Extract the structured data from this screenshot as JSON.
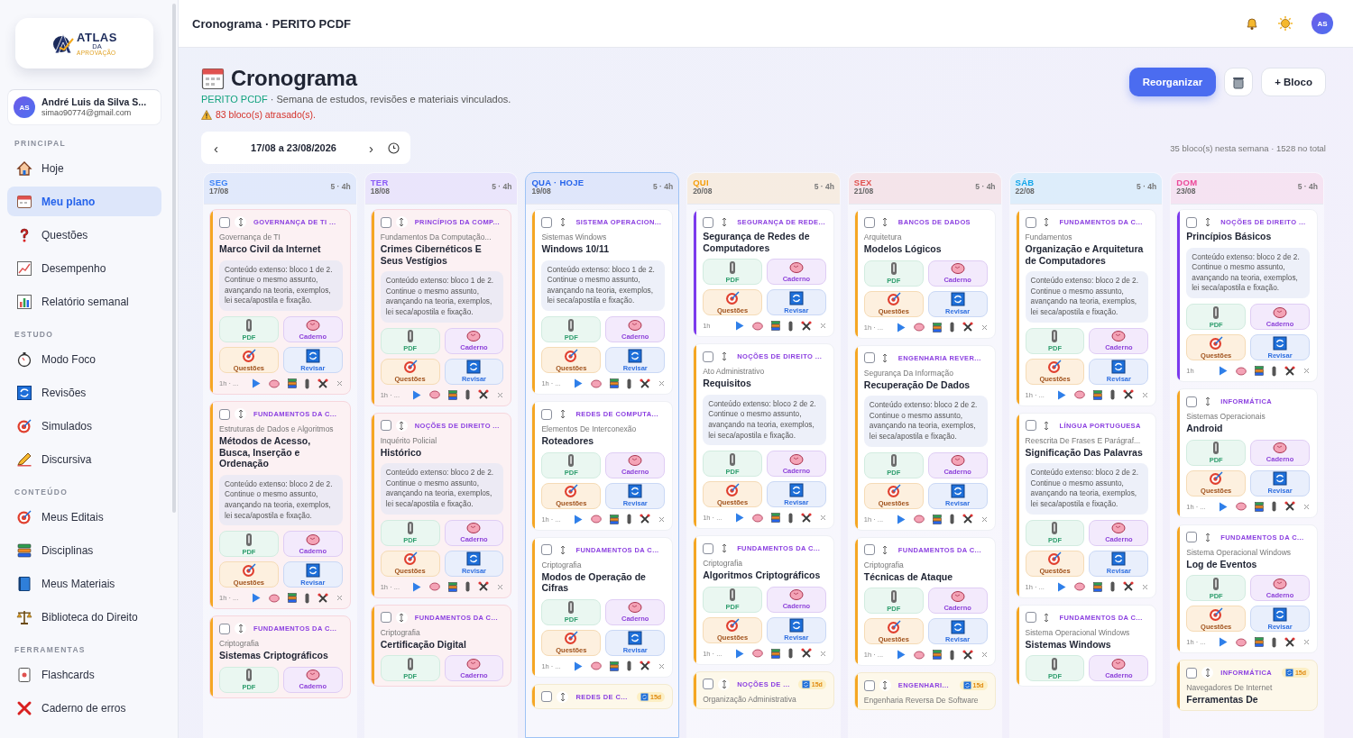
{
  "sidebar": {
    "logo": {
      "name": "ATLAS",
      "small": "DA",
      "tagline": "APROVAÇÃO"
    },
    "user": {
      "initials": "AS",
      "name": "André Luis da Silva S...",
      "email": "simao90774@gmail.com"
    },
    "sections": [
      {
        "title": "PRINCIPAL",
        "items": [
          {
            "label": "Hoje",
            "selected": false
          },
          {
            "label": "Meu plano",
            "selected": true
          },
          {
            "label": "Questões",
            "selected": false
          },
          {
            "label": "Desempenho",
            "selected": false
          },
          {
            "label": "Relatório semanal",
            "selected": false
          }
        ]
      },
      {
        "title": "ESTUDO",
        "items": [
          {
            "label": "Modo Foco",
            "selected": false
          },
          {
            "label": "Revisões",
            "selected": false
          },
          {
            "label": "Simulados",
            "selected": false
          },
          {
            "label": "Discursiva",
            "selected": false
          }
        ]
      },
      {
        "title": "CONTEÚDO",
        "items": [
          {
            "label": "Meus Editais",
            "selected": false
          },
          {
            "label": "Disciplinas",
            "selected": false
          },
          {
            "label": "Meus Materiais",
            "selected": false
          },
          {
            "label": "Biblioteca do Direito",
            "selected": false
          }
        ]
      },
      {
        "title": "FERRAMENTAS",
        "items": [
          {
            "label": "Flashcards",
            "selected": false
          },
          {
            "label": "Caderno de erros",
            "selected": false
          }
        ]
      }
    ]
  },
  "topbar": {
    "title": "Cronograma · PERITO PCDF",
    "avatar": "AS"
  },
  "header": {
    "title": "Cronograma",
    "project": "PERITO PCDF",
    "subtitle": "· Semana de estudos, revisões e materiais vinculados.",
    "warning": "83 bloco(s) atrasado(s).",
    "primary_button": "Reorganizar",
    "add_button": "+ Bloco"
  },
  "week": {
    "prev": "‹",
    "range": "17/08 a 23/08/2026",
    "next": "›",
    "summary": "35 bloco(s) nesta semana · 1528 no total"
  },
  "days": [
    {
      "name": "SEG",
      "date": "17/08",
      "summary": "5 · 4h",
      "color": "#3b82f6",
      "today": false,
      "cards": [
        {
          "subject": "GOVERNANÇA DE TI ...",
          "topic": "Governança de TI",
          "title": "Marco Civil da Internet",
          "note": "Conteúdo extenso: bloco 1 de 2. Continue o mesmo assunto, avançando na teoria, exemplos, lei seca/apostila e fixação.",
          "actions": [
            "PDF",
            "Caderno",
            "Questões",
            "Revisar"
          ],
          "time": "1h · ...",
          "color": "#f5a623",
          "overdue": true,
          "due_review": false,
          "checked": false
        },
        {
          "subject": "FUNDAMENTOS DA C...",
          "topic": "Estruturas de Dados e Algoritmos",
          "title": "Métodos de Acesso, Busca, Inserção e Ordenação",
          "note": "Conteúdo extenso: bloco 2 de 2. Continue o mesmo assunto, avançando na teoria, exemplos, lei seca/apostila e fixação.",
          "actions": [
            "PDF",
            "Caderno",
            "Questões",
            "Revisar"
          ],
          "time": "1h · ...",
          "color": "#f5a623",
          "overdue": true,
          "due_review": false,
          "checked": false
        },
        {
          "subject": "FUNDAMENTOS DA C...",
          "topic": "Criptografia",
          "title": "Sistemas Criptográficos",
          "actions": [
            "PDF",
            "Caderno"
          ],
          "color": "#f5a623",
          "overdue": true,
          "due_review": false,
          "checked": false
        }
      ]
    },
    {
      "name": "TER",
      "date": "18/08",
      "summary": "5 · 4h",
      "color": "#8b5cf6",
      "today": false,
      "cards": [
        {
          "subject": "PRINCÍPIOS DA COMP...",
          "topic": "Fundamentos Da Computação...",
          "title": "Crimes Cibernéticos E Seus Vestígios",
          "note": "Conteúdo extenso: bloco 1 de 2. Continue o mesmo assunto, avançando na teoria, exemplos, lei seca/apostila e fixação.",
          "actions": [
            "PDF",
            "Caderno",
            "Questões",
            "Revisar"
          ],
          "time": "1h · ...",
          "color": "#f5a623",
          "overdue": true,
          "due_review": false,
          "checked": false
        },
        {
          "subject": "NOÇÕES DE DIREITO ...",
          "topic": "Inquérito Policial",
          "title": "Histórico",
          "note": "Conteúdo extenso: bloco 2 de 2. Continue o mesmo assunto, avançando na teoria, exemplos, lei seca/apostila e fixação.",
          "actions": [
            "PDF",
            "Caderno",
            "Questões",
            "Revisar"
          ],
          "time": "1h · ...",
          "color": "#f5a623",
          "overdue": true,
          "due_review": false,
          "checked": false
        },
        {
          "subject": "FUNDAMENTOS DA C...",
          "topic": "Criptografia",
          "title": "Certificação Digital",
          "actions": [
            "PDF",
            "Caderno"
          ],
          "color": "#f5a623",
          "overdue": true,
          "due_review": false,
          "checked": false
        }
      ]
    },
    {
      "name": "QUA · HOJE",
      "date": "19/08",
      "summary": "5 · 4h",
      "color": "#2563eb",
      "today": true,
      "cards": [
        {
          "subject": "SISTEMA OPERACION...",
          "topic": "Sistemas Windows",
          "title": "Windows 10/11",
          "note": "Conteúdo extenso: bloco 1 de 2. Continue o mesmo assunto, avançando na teoria, exemplos, lei seca/apostila e fixação.",
          "actions": [
            "PDF",
            "Caderno",
            "Questões",
            "Revisar"
          ],
          "time": "1h · ...",
          "color": "#f5a623",
          "overdue": false,
          "due_review": false,
          "checked": false
        },
        {
          "subject": "REDES DE COMPUTA...",
          "topic": "Elementos De Interconexão",
          "title": "Roteadores",
          "actions": [
            "PDF",
            "Caderno",
            "Questões",
            "Revisar"
          ],
          "time": "1h · ...",
          "color": "#f5a623",
          "overdue": false,
          "due_review": false,
          "checked": false
        },
        {
          "subject": "FUNDAMENTOS DA C...",
          "topic": "Criptografia",
          "title": "Modos de Operação de Cifras",
          "actions": [
            "PDF",
            "Caderno",
            "Questões",
            "Revisar"
          ],
          "time": "1h · ...",
          "color": "#f5a623",
          "overdue": false,
          "due_review": false,
          "checked": false
        },
        {
          "subject": "REDES DE C...",
          "badge": "15d",
          "color": "#f5a623",
          "overdue": false,
          "due_review": true,
          "checked": false
        }
      ]
    },
    {
      "name": "QUI",
      "date": "20/08",
      "summary": "5 · 4h",
      "color": "#f59e0b",
      "today": false,
      "cards": [
        {
          "subject": "SEGURANÇA DE REDE...",
          "title": "Segurança de Redes de Computadores",
          "actions": [
            "PDF",
            "Caderno",
            "Questões",
            "Revisar"
          ],
          "time": "1h",
          "color": "#7c3aed",
          "overdue": false,
          "due_review": false,
          "checked": false
        },
        {
          "subject": "NOÇÕES DE DIREITO ...",
          "topic": "Ato Administrativo",
          "title": "Requisitos",
          "note": "Conteúdo extenso: bloco 2 de 2. Continue o mesmo assunto, avançando na teoria, exemplos, lei seca/apostila e fixação.",
          "actions": [
            "PDF",
            "Caderno",
            "Questões",
            "Revisar"
          ],
          "time": "1h · ...",
          "color": "#f5a623",
          "overdue": false,
          "due_review": false,
          "checked": false
        },
        {
          "subject": "FUNDAMENTOS DA C...",
          "topic": "Criptografia",
          "title": "Algoritmos Criptográficos",
          "actions": [
            "PDF",
            "Caderno",
            "Questões",
            "Revisar"
          ],
          "time": "1h · ...",
          "color": "#f5a623",
          "overdue": false,
          "due_review": false,
          "checked": false
        },
        {
          "subject": "NOÇÕES DE ...",
          "badge": "15d",
          "topic": "Organização Administrativa",
          "color": "#f5a623",
          "overdue": false,
          "due_review": true,
          "checked": false
        }
      ]
    },
    {
      "name": "SEX",
      "date": "21/08",
      "summary": "5 · 4h",
      "color": "#e0524f",
      "today": false,
      "cards": [
        {
          "subject": "BANCOS DE DADOS",
          "topic": "Arquitetura",
          "title": "Modelos Lógicos",
          "actions": [
            "PDF",
            "Caderno",
            "Questões",
            "Revisar"
          ],
          "time": "1h · ...",
          "color": "#f5a623",
          "overdue": false,
          "due_review": false,
          "checked": false
        },
        {
          "subject": "ENGENHARIA REVER...",
          "topic": "Segurança Da Informação",
          "title": "Recuperação De Dados",
          "note": "Conteúdo extenso: bloco 2 de 2. Continue o mesmo assunto, avançando na teoria, exemplos, lei seca/apostila e fixação.",
          "actions": [
            "PDF",
            "Caderno",
            "Questões",
            "Revisar"
          ],
          "time": "1h · ...",
          "color": "#f5a623",
          "overdue": false,
          "due_review": false,
          "checked": false
        },
        {
          "subject": "FUNDAMENTOS DA C...",
          "topic": "Criptografia",
          "title": "Técnicas de Ataque",
          "actions": [
            "PDF",
            "Caderno",
            "Questões",
            "Revisar"
          ],
          "time": "1h · ...",
          "color": "#f5a623",
          "overdue": false,
          "due_review": false,
          "checked": false
        },
        {
          "subject": "ENGENHARI...",
          "badge": "15d",
          "topic": "Engenharia Reversa De Software",
          "color": "#f5a623",
          "overdue": false,
          "due_review": true,
          "checked": false
        }
      ]
    },
    {
      "name": "SÁB",
      "date": "22/08",
      "summary": "5 · 4h",
      "color": "#0ea5e9",
      "today": false,
      "cards": [
        {
          "subject": "FUNDAMENTOS DA C...",
          "topic": "Fundamentos",
          "title": "Organização e Arquitetura de Computadores",
          "note": "Conteúdo extenso: bloco 2 de 2. Continue o mesmo assunto, avançando na teoria, exemplos, lei seca/apostila e fixação.",
          "actions": [
            "PDF",
            "Caderno",
            "Questões",
            "Revisar"
          ],
          "time": "1h · ...",
          "color": "#f5a623",
          "overdue": false,
          "due_review": false,
          "checked": false
        },
        {
          "subject": "LÍNGUA PORTUGUESA",
          "topic": "Reescrita De Frases E Parágraf...",
          "title": "Significação Das Palavras",
          "note": "Conteúdo extenso: bloco 2 de 2. Continue o mesmo assunto, avançando na teoria, exemplos, lei seca/apostila e fixação.",
          "actions": [
            "PDF",
            "Caderno",
            "Questões",
            "Revisar"
          ],
          "time": "1h · ...",
          "color": "#f5a623",
          "overdue": false,
          "due_review": false,
          "checked": false
        },
        {
          "subject": "FUNDAMENTOS DA C...",
          "topic": "Sistema Operacional Windows",
          "title": "Sistemas Windows",
          "actions": [
            "PDF",
            "Caderno"
          ],
          "color": "#f5a623",
          "overdue": false,
          "due_review": false,
          "checked": false
        }
      ]
    },
    {
      "name": "DOM",
      "date": "23/08",
      "summary": "5 · 4h",
      "color": "#ec4899",
      "today": false,
      "cards": [
        {
          "subject": "NOÇÕES DE DIREITO ...",
          "title": "Princípios Básicos",
          "note": "Conteúdo extenso: bloco 2 de 2. Continue o mesmo assunto, avançando na teoria, exemplos, lei seca/apostila e fixação.",
          "actions": [
            "PDF",
            "Caderno",
            "Questões",
            "Revisar"
          ],
          "time": "1h",
          "color": "#7c3aed",
          "overdue": false,
          "due_review": false,
          "checked": false
        },
        {
          "subject": "INFORMÁTICA",
          "topic": "Sistemas Operacionais",
          "title": "Android",
          "actions": [
            "PDF",
            "Caderno",
            "Questões",
            "Revisar"
          ],
          "time": "1h · ...",
          "color": "#f5a623",
          "overdue": false,
          "due_review": false,
          "checked": false
        },
        {
          "subject": "FUNDAMENTOS DA C...",
          "topic": "Sistema Operacional Windows",
          "title": "Log de Eventos",
          "actions": [
            "PDF",
            "Caderno",
            "Questões",
            "Revisar"
          ],
          "time": "1h · ...",
          "color": "#f5a623",
          "overdue": false,
          "due_review": false,
          "checked": false
        },
        {
          "subject": "INFORMÁTICA",
          "badge": "15d",
          "topic": "Navegadores De Internet",
          "title": "Ferramentas De",
          "color": "#f5a623",
          "overdue": false,
          "due_review": true,
          "checked": false
        }
      ]
    }
  ]
}
